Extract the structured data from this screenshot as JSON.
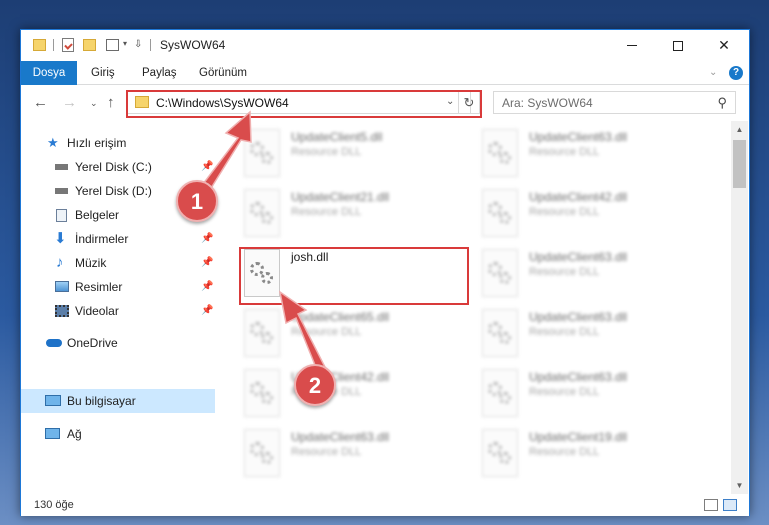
{
  "window": {
    "title": "SysWOW64",
    "min_glyph": "",
    "max_glyph": "",
    "close_glyph": "✕"
  },
  "ribbon": {
    "tabs": [
      {
        "label": "Dosya"
      },
      {
        "label": "Giriş"
      },
      {
        "label": "Paylaş"
      },
      {
        "label": "Görünüm"
      }
    ],
    "help": "?"
  },
  "nav": {
    "back": "←",
    "forward": "→",
    "recent": "⌄",
    "up": "↑",
    "address": "C:\\Windows\\SysWOW64",
    "refresh": "↻",
    "search_placeholder": "Ara: SysWOW64",
    "search_glyph": "⚲"
  },
  "sidebar": {
    "items": [
      {
        "label": "Hızlı erişim",
        "icon": "star-icon",
        "pinned": false
      },
      {
        "label": "Yerel Disk (C:)",
        "icon": "drive-icon",
        "pinned": true
      },
      {
        "label": "Yerel Disk (D:)",
        "icon": "drive-icon",
        "pinned": true
      },
      {
        "label": "Belgeler",
        "icon": "documents-icon",
        "pinned": true
      },
      {
        "label": "İndirmeler",
        "icon": "download-icon",
        "pinned": true
      },
      {
        "label": "Müzik",
        "icon": "music-icon",
        "pinned": true
      },
      {
        "label": "Resimler",
        "icon": "pictures-icon",
        "pinned": true
      },
      {
        "label": "Videolar",
        "icon": "videos-icon",
        "pinned": true
      },
      {
        "label": "OneDrive",
        "icon": "cloud-icon",
        "pinned": false
      },
      {
        "label": "Bu bilgisayar",
        "icon": "computer-icon",
        "pinned": false,
        "selected": true
      },
      {
        "label": "Ağ",
        "icon": "network-icon",
        "pinned": false
      }
    ],
    "pin_glyph": "📌"
  },
  "files": {
    "left": [
      {
        "name": "UpdateClient5.dll",
        "type": "Resource DLL"
      },
      {
        "name": "UpdateClient21.dll",
        "type": "Resource DLL"
      },
      {
        "name": "josh.dll",
        "type": ""
      },
      {
        "name": "UpdateClient65.dll",
        "type": "Resource DLL"
      },
      {
        "name": "UpdateClient42.dll",
        "type": "Resource DLL"
      },
      {
        "name": "UpdateClient63.dll",
        "type": "Resource DLL"
      }
    ],
    "right": [
      {
        "name": "UpdateClient63.dll",
        "type": "Resource DLL"
      },
      {
        "name": "UpdateClient42.dll",
        "type": "Resource DLL"
      },
      {
        "name": "UpdateClient63.dll",
        "type": "Resource DLL"
      },
      {
        "name": "UpdateClient63.dll",
        "type": "Resource DLL"
      },
      {
        "name": "UpdateClient63.dll",
        "type": "Resource DLL"
      },
      {
        "name": "UpdateClient19.dll",
        "type": "Resource DLL"
      }
    ]
  },
  "status": {
    "item_count": "130 öğe"
  },
  "annotations": {
    "badge1": "1",
    "badge2": "2",
    "color": "#d94c4c"
  }
}
